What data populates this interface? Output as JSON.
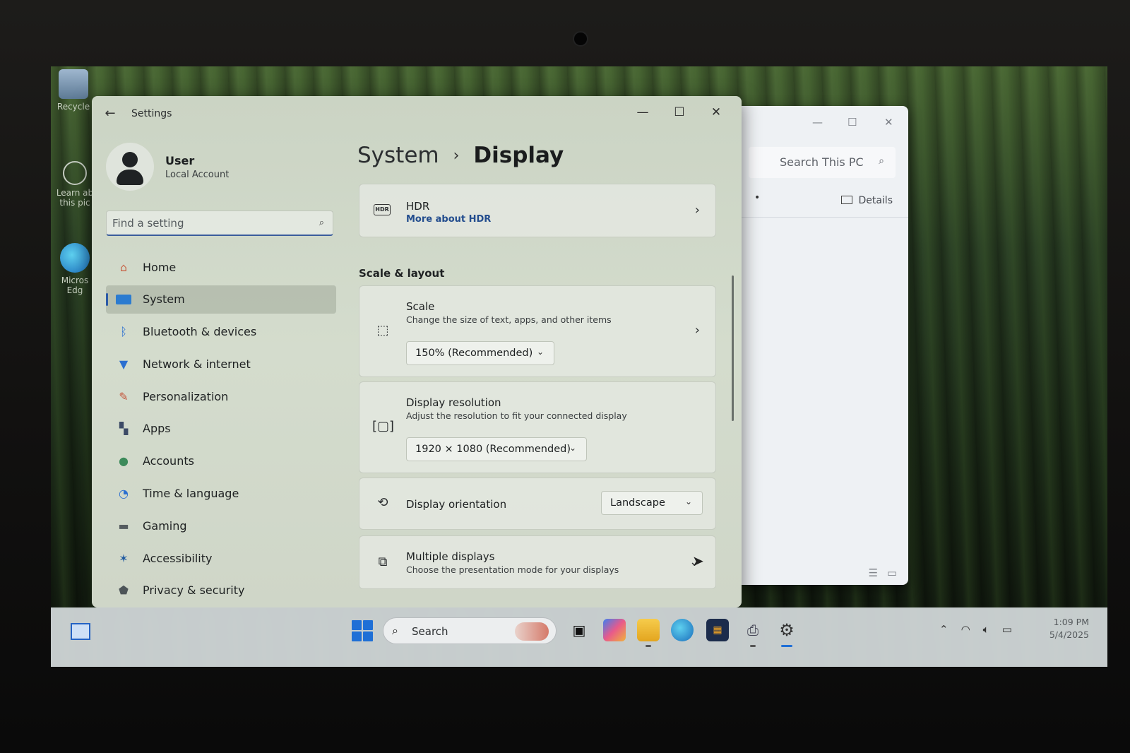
{
  "settings_window": {
    "title": "Settings",
    "back_icon": "back-arrow-icon",
    "minimize_glyph": "—",
    "maximize_glyph": "☐",
    "close_glyph": "✕"
  },
  "profile": {
    "name": "User",
    "account_type": "Local Account"
  },
  "search": {
    "placeholder": "Find a setting"
  },
  "nav": {
    "items": [
      {
        "label": "Home",
        "icon": "home-icon"
      },
      {
        "label": "System",
        "icon": "system-monitor-icon",
        "active": true
      },
      {
        "label": "Bluetooth & devices",
        "icon": "bluetooth-icon"
      },
      {
        "label": "Network & internet",
        "icon": "wifi-icon"
      },
      {
        "label": "Personalization",
        "icon": "paintbrush-icon"
      },
      {
        "label": "Apps",
        "icon": "apps-icon"
      },
      {
        "label": "Accounts",
        "icon": "accounts-icon"
      },
      {
        "label": "Time & language",
        "icon": "globe-clock-icon"
      },
      {
        "label": "Gaming",
        "icon": "gamepad-icon"
      },
      {
        "label": "Accessibility",
        "icon": "accessibility-icon"
      },
      {
        "label": "Privacy & security",
        "icon": "shield-icon"
      }
    ]
  },
  "breadcrumb": {
    "parent": "System",
    "separator": "›",
    "current": "Display"
  },
  "hdr_card": {
    "icon_text": "HDR",
    "title": "HDR",
    "link": "More about HDR"
  },
  "scale_layout": {
    "heading": "Scale & layout",
    "scale": {
      "title": "Scale",
      "description": "Change the size of text, apps, and other items",
      "value": "150% (Recommended)"
    },
    "resolution": {
      "title": "Display resolution",
      "description": "Adjust the resolution to fit your connected display",
      "value": "1920 × 1080 (Recommended)"
    },
    "orientation": {
      "title": "Display orientation",
      "value": "Landscape"
    },
    "multiple": {
      "title": "Multiple displays",
      "description": "Choose the presentation mode for your displays"
    }
  },
  "explorer_window": {
    "search_placeholder": "Search This PC",
    "details_label": "Details",
    "dot": "•"
  },
  "desktop": {
    "icons": [
      {
        "label": "Recycle",
        "icon": "recycle-bin-icon"
      },
      {
        "label": "Learn ab this pic",
        "icon": "learn-picture-icon"
      },
      {
        "label": "Micros Edg",
        "icon": "edge-shortcut-icon"
      }
    ]
  },
  "taskbar": {
    "search_label": "Search",
    "apps": [
      "task-view-icon",
      "copilot-icon",
      "file-explorer-icon",
      "edge-icon",
      "store-icon",
      "devices-icon",
      "settings-gear-icon"
    ],
    "time": "1:09 PM",
    "date": "5/4/2025"
  },
  "colors": {
    "accent": "#2c5aa8",
    "link": "#234d8e"
  }
}
